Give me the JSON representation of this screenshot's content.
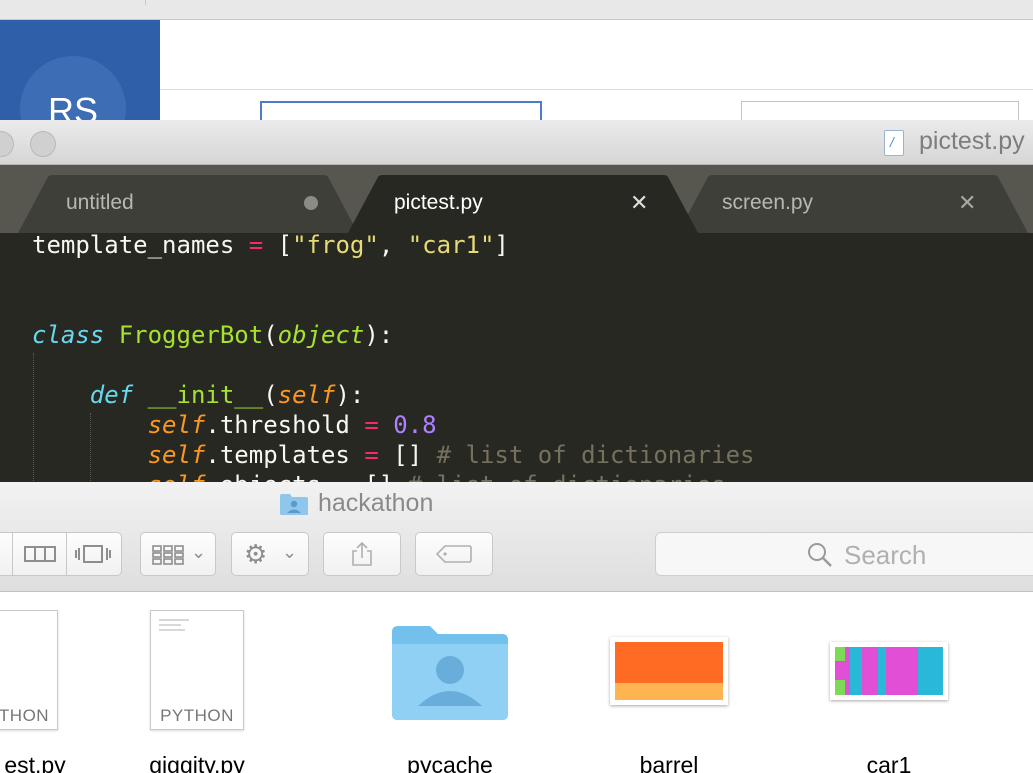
{
  "background_window": {
    "avatar_initials": "RS"
  },
  "editor": {
    "window_title": "pictest.py",
    "tabs": [
      {
        "label": "untitled",
        "state": "modified"
      },
      {
        "label": "pictest.py",
        "state": "active"
      },
      {
        "label": "screen.py",
        "state": "inactive"
      }
    ],
    "code_lines": [
      "template_names = [\"frog\", \"car1\"]",
      "",
      "",
      "class FroggerBot(object):",
      "",
      "    def __init__(self):",
      "        self.threshold = 0.8",
      "        self.templates = [] # list of dictionaries",
      "        self.objects = [] # list of dictionaries"
    ],
    "colors": {
      "background": "#272822",
      "keyword": "#66d9ef",
      "string": "#e6db74",
      "operator": "#f92672",
      "number": "#ae81ff",
      "comment": "#75715e",
      "self": "#fd971f",
      "class_name": "#a6e22e"
    }
  },
  "finder": {
    "window_title": "hackathon",
    "toolbar": {
      "view_icons": [
        "column-view-icon",
        "coverflow-view-icon"
      ],
      "arrange_icon": "arrange-grid-icon",
      "action_icon": "gear-icon",
      "share_icon": "share-icon",
      "tag_icon": "tag-icon"
    },
    "search_placeholder": "Search",
    "items": [
      {
        "name": "est.py",
        "kind": "python-file",
        "badge": "THON"
      },
      {
        "name": "giggity.py",
        "kind": "python-file",
        "badge": "PYTHON"
      },
      {
        "name": "pycache",
        "kind": "folder"
      },
      {
        "name": "barrel",
        "kind": "image"
      },
      {
        "name": "car1",
        "kind": "image"
      }
    ]
  }
}
